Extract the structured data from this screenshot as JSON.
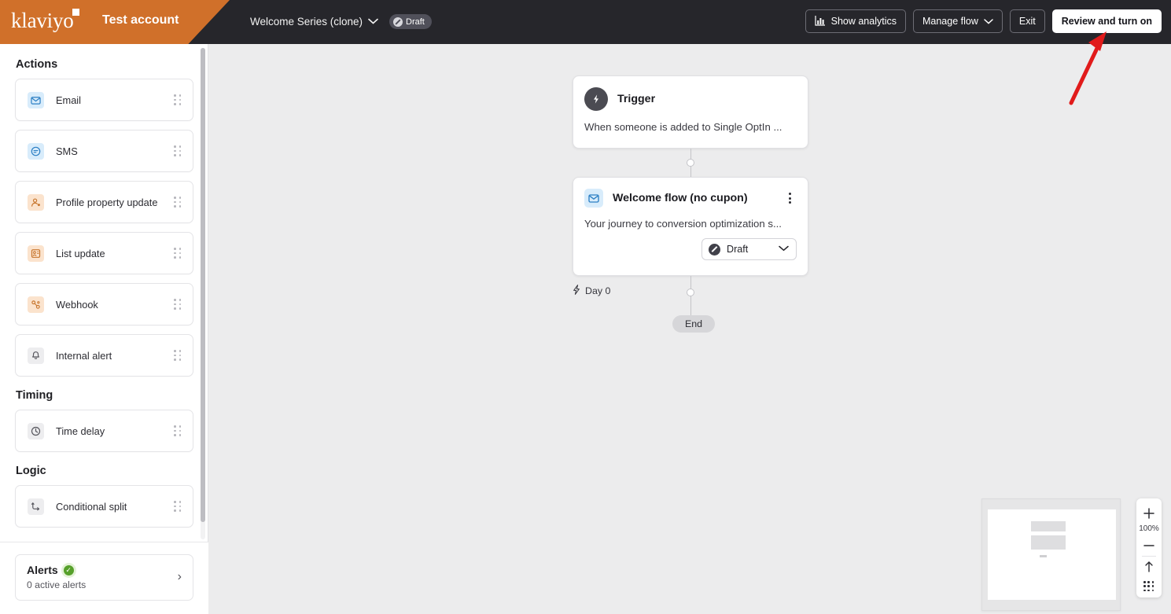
{
  "header": {
    "logo_text": "klaviyo",
    "logo_icon": "klaviyo-square-dot",
    "account_name": "Test account",
    "flow_name": "Welcome Series (clone)",
    "flow_chevron_icon": "chevron-down-icon",
    "status_badge": "Draft",
    "status_badge_icon": "draft-slash-icon",
    "buttons": {
      "analytics_label": "Show analytics",
      "analytics_icon": "bar-chart-icon",
      "manage_label": "Manage flow",
      "manage_chevron_icon": "chevron-down-icon",
      "exit_label": "Exit",
      "review_label": "Review and turn on"
    },
    "colors": {
      "brand_orange": "#d0702a",
      "bar_dark": "#26262b"
    }
  },
  "sidebar": {
    "sections": [
      {
        "title": "Actions",
        "items": [
          {
            "label": "Email",
            "icon": "envelope-icon",
            "tone": "blue"
          },
          {
            "label": "SMS",
            "icon": "chat-bubble-icon",
            "tone": "blue"
          },
          {
            "label": "Profile property update",
            "icon": "person-edit-icon",
            "tone": "orange"
          },
          {
            "label": "List update",
            "icon": "list-card-icon",
            "tone": "orange"
          },
          {
            "label": "Webhook",
            "icon": "webhook-icon",
            "tone": "orange"
          },
          {
            "label": "Internal alert",
            "icon": "bell-icon",
            "tone": "grey"
          }
        ]
      },
      {
        "title": "Timing",
        "items": [
          {
            "label": "Time delay",
            "icon": "clock-icon",
            "tone": "grey"
          }
        ]
      },
      {
        "title": "Logic",
        "items": [
          {
            "label": "Conditional split",
            "icon": "split-arrows-icon",
            "tone": "grey"
          }
        ]
      }
    ],
    "drag_handle_icon": "drag-dots-icon",
    "alerts": {
      "title": "Alerts",
      "badge_icon": "check-circle-icon",
      "badge_color": "#56a02a",
      "subtitle": "0 active alerts",
      "arrow_icon": "chevron-right-icon"
    }
  },
  "canvas": {
    "background": "#ececed",
    "trigger": {
      "icon": "lightning-bolt-circle-icon",
      "title": "Trigger",
      "description": "When someone is added to Single OptIn ..."
    },
    "email_node": {
      "icon": "envelope-icon",
      "title": "Welcome flow (no cupon)",
      "menu_icon": "kebab-menu-icon",
      "description": "Your journey to conversion optimization s...",
      "status_value": "Draft",
      "status_icon": "draft-slash-icon",
      "status_chevron_icon": "chevron-down-icon"
    },
    "day_label": "Day 0",
    "day_icon": "lightning-bolt-icon",
    "end_label": "End",
    "connector_dot_icon": "connector-node-icon"
  },
  "controls": {
    "zoom_in_icon": "plus-icon",
    "zoom_level": "100%",
    "zoom_out_icon": "minus-icon",
    "fit_icon": "arrow-up-icon",
    "grid_icon": "grid-dots-icon",
    "minimap_name": "flow-minimap"
  },
  "annotation": {
    "arrow_color": "#e11b1b",
    "arrow_name": "red-pointer-arrow",
    "points_to": "Review and turn on"
  }
}
